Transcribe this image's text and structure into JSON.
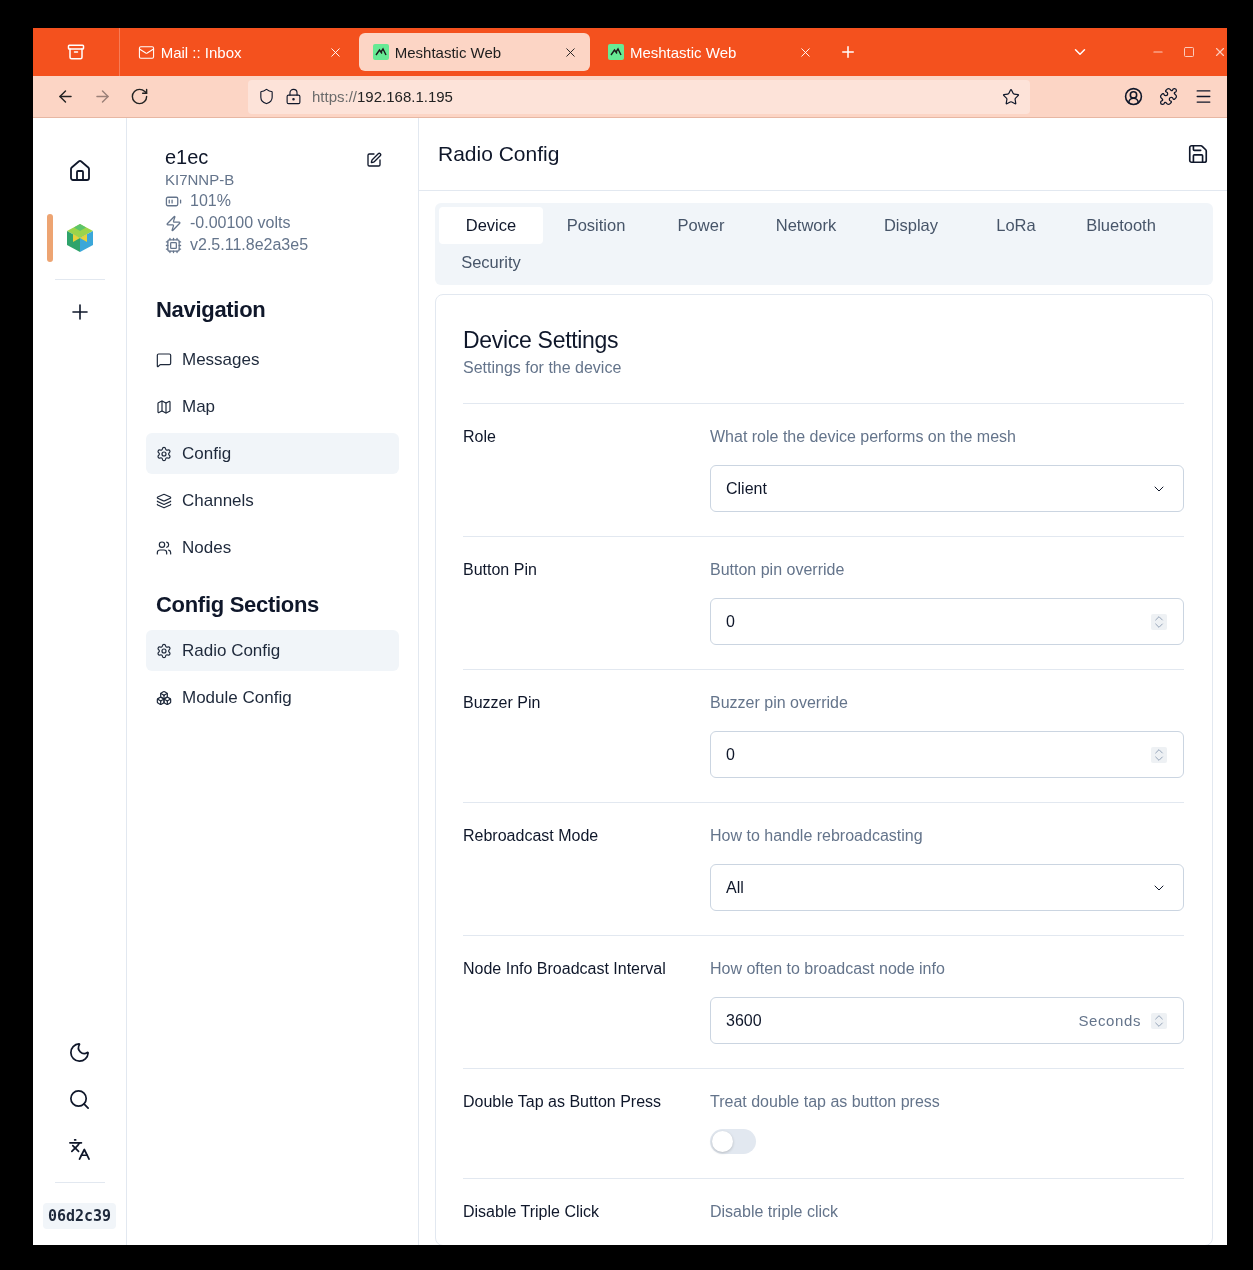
{
  "browser": {
    "tabs": [
      {
        "title": "Mail :: Inbox",
        "kind": "mail",
        "selected": false
      },
      {
        "title": "Meshtastic Web",
        "kind": "meshtastic",
        "selected": true
      },
      {
        "title": "Meshtastic Web",
        "kind": "meshtastic",
        "selected": false
      }
    ],
    "nav_buttons": [
      {
        "kind": "back",
        "disabled": false
      },
      {
        "kind": "forward",
        "disabled": true
      },
      {
        "kind": "reload",
        "disabled": false
      }
    ],
    "url": {
      "scheme": "https://",
      "host": "192.168.1.195"
    }
  },
  "rail": {
    "node_selected": true,
    "commit": "06d2c39"
  },
  "device": {
    "name": "e1ec",
    "callsign": "KI7NNP-B",
    "battery": "101%",
    "voltage": "-0.00100 volts",
    "firmware": "v2.5.11.8e2a3e5"
  },
  "navigation": {
    "title": "Navigation",
    "items": [
      {
        "label": "Messages",
        "kind": "messages",
        "selected": false
      },
      {
        "label": "Map",
        "kind": "map",
        "selected": false
      },
      {
        "label": "Config",
        "kind": "config",
        "selected": true
      },
      {
        "label": "Channels",
        "kind": "channels",
        "selected": false
      },
      {
        "label": "Nodes",
        "kind": "nodes",
        "selected": false
      }
    ]
  },
  "config_sections": {
    "title": "Config Sections",
    "items": [
      {
        "label": "Radio Config",
        "kind": "config",
        "selected": true
      },
      {
        "label": "Module Config",
        "kind": "modules",
        "selected": false
      }
    ]
  },
  "page": {
    "title": "Radio Config",
    "tabs": [
      {
        "label": "Device",
        "selected": true
      },
      {
        "label": "Position",
        "selected": false
      },
      {
        "label": "Power",
        "selected": false
      },
      {
        "label": "Network",
        "selected": false
      },
      {
        "label": "Display",
        "selected": false
      },
      {
        "label": "LoRa",
        "selected": false
      },
      {
        "label": "Bluetooth",
        "selected": false
      },
      {
        "label": "Security",
        "selected": false
      }
    ],
    "card": {
      "title": "Device Settings",
      "subtitle": "Settings for the device",
      "fields": [
        {
          "kind": "select",
          "label": "Role",
          "description": "What role the device performs on the mesh",
          "value": "Client"
        },
        {
          "kind": "number",
          "label": "Button Pin",
          "description": "Button pin override",
          "value": "0"
        },
        {
          "kind": "number",
          "label": "Buzzer Pin",
          "description": "Buzzer pin override",
          "value": "0"
        },
        {
          "kind": "select",
          "label": "Rebroadcast Mode",
          "description": "How to handle rebroadcasting",
          "value": "All"
        },
        {
          "kind": "number",
          "label": "Node Info Broadcast Interval",
          "description": "How often to broadcast node info",
          "value": "3600",
          "unit": "Seconds"
        },
        {
          "kind": "toggle",
          "label": "Double Tap as Button Press",
          "description": "Treat double tap as button press",
          "on": false
        },
        {
          "kind": "cut",
          "label": "Disable Triple Click",
          "description": "Disable triple click"
        }
      ]
    }
  }
}
